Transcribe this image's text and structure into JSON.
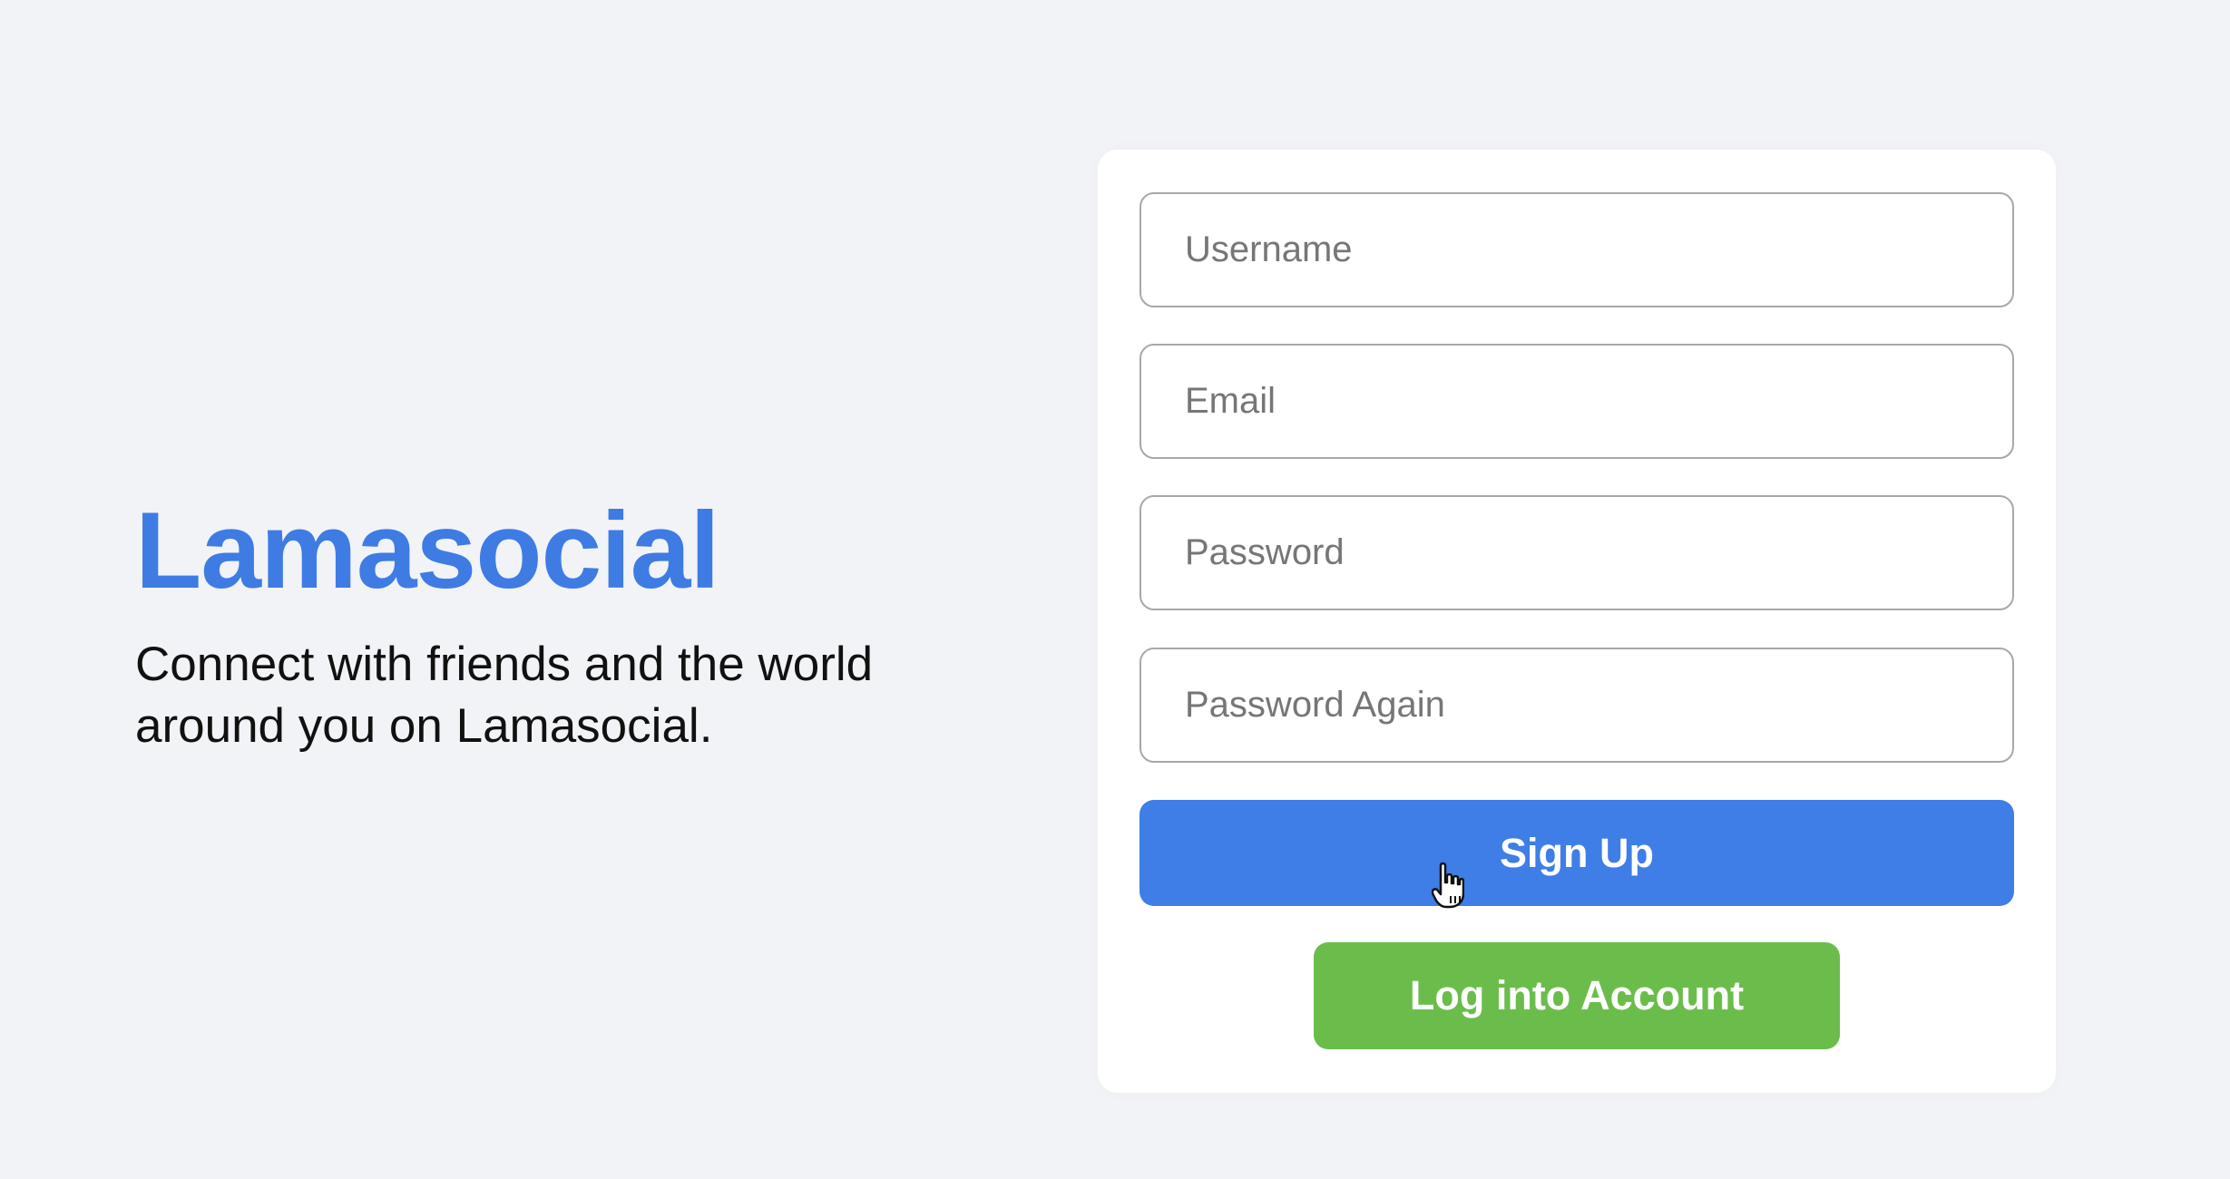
{
  "brand": {
    "logo": "Lamasocial",
    "tagline": "Connect with friends and the world around you on Lamasocial."
  },
  "form": {
    "username_placeholder": "Username",
    "username_value": "",
    "email_placeholder": "Email",
    "email_value": "",
    "password_placeholder": "Password",
    "password_value": "",
    "password_again_placeholder": "Password Again",
    "password_again_value": "",
    "signup_label": "Sign Up",
    "login_label": "Log into Account"
  },
  "colors": {
    "brand_blue": "#3e7ce4",
    "signup_button": "#3e7ee6",
    "login_button": "#6bbd4b",
    "page_background": "#f2f3f6"
  },
  "icons": {
    "cursor": "hand-pointer-cursor"
  }
}
